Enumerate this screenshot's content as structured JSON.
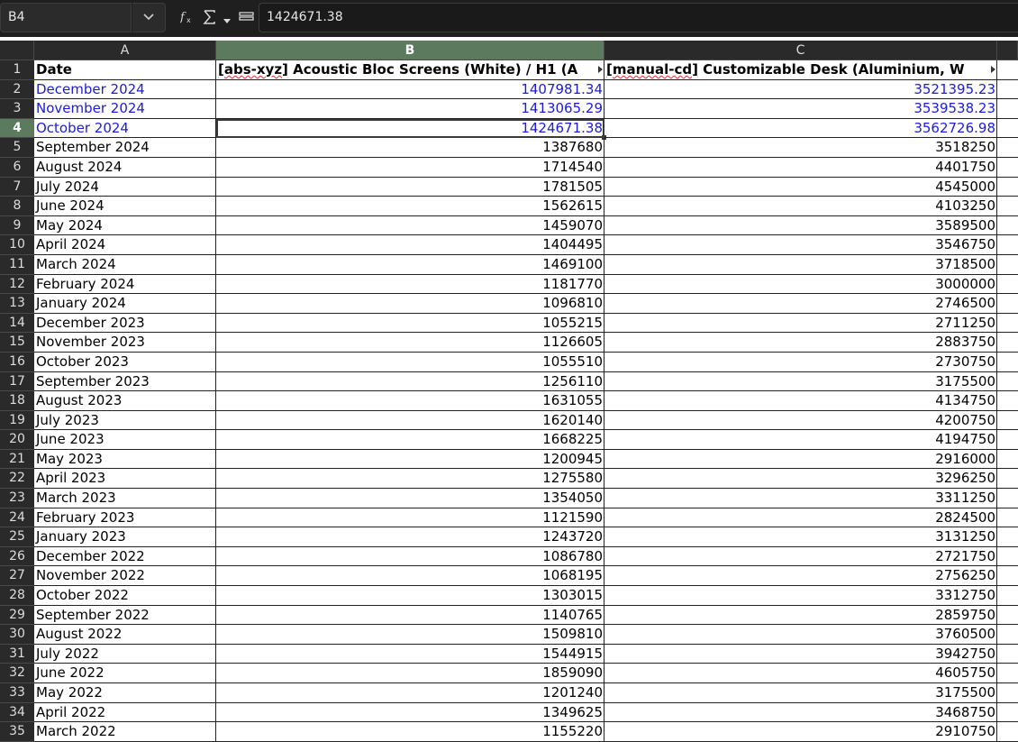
{
  "name_box": "B4",
  "formula": "1424671.38",
  "columns": [
    "A",
    "B",
    "C"
  ],
  "header_row": {
    "row": "1",
    "a": "Date",
    "b_tag": "[abs-xyz]",
    "b_rest": " Acoustic Bloc Screens (White) / H1 (A",
    "c_tag": "[manual-cd]",
    "c_rest": " Customizable Desk (Aluminium, W"
  },
  "rows": [
    {
      "row": "2",
      "date": "December 2024",
      "b": "1407981.34",
      "c": "3521395.23",
      "forecast": true
    },
    {
      "row": "3",
      "date": "November 2024",
      "b": "1413065.29",
      "c": "3539538.23",
      "forecast": true
    },
    {
      "row": "4",
      "date": "October 2024",
      "b": "1424671.38",
      "c": "3562726.98",
      "forecast": true
    },
    {
      "row": "5",
      "date": "September 2024",
      "b": "1387680",
      "c": "3518250"
    },
    {
      "row": "6",
      "date": "August 2024",
      "b": "1714540",
      "c": "4401750"
    },
    {
      "row": "7",
      "date": "July 2024",
      "b": "1781505",
      "c": "4545000"
    },
    {
      "row": "8",
      "date": "June 2024",
      "b": "1562615",
      "c": "4103250"
    },
    {
      "row": "9",
      "date": "May 2024",
      "b": "1459070",
      "c": "3589500"
    },
    {
      "row": "10",
      "date": "April 2024",
      "b": "1404495",
      "c": "3546750"
    },
    {
      "row": "11",
      "date": "March 2024",
      "b": "1469100",
      "c": "3718500"
    },
    {
      "row": "12",
      "date": "February 2024",
      "b": "1181770",
      "c": "3000000"
    },
    {
      "row": "13",
      "date": "January 2024",
      "b": "1096810",
      "c": "2746500"
    },
    {
      "row": "14",
      "date": "December 2023",
      "b": "1055215",
      "c": "2711250"
    },
    {
      "row": "15",
      "date": "November 2023",
      "b": "1126605",
      "c": "2883750"
    },
    {
      "row": "16",
      "date": "October 2023",
      "b": "1055510",
      "c": "2730750"
    },
    {
      "row": "17",
      "date": "September 2023",
      "b": "1256110",
      "c": "3175500"
    },
    {
      "row": "18",
      "date": "August 2023",
      "b": "1631055",
      "c": "4134750"
    },
    {
      "row": "19",
      "date": "July 2023",
      "b": "1620140",
      "c": "4200750"
    },
    {
      "row": "20",
      "date": "June 2023",
      "b": "1668225",
      "c": "4194750"
    },
    {
      "row": "21",
      "date": "May 2023",
      "b": "1200945",
      "c": "2916000"
    },
    {
      "row": "22",
      "date": "April 2023",
      "b": "1275580",
      "c": "3296250"
    },
    {
      "row": "23",
      "date": "March 2023",
      "b": "1354050",
      "c": "3311250"
    },
    {
      "row": "24",
      "date": "February 2023",
      "b": "1121590",
      "c": "2824500"
    },
    {
      "row": "25",
      "date": "January 2023",
      "b": "1243720",
      "c": "3131250"
    },
    {
      "row": "26",
      "date": "December 2022",
      "b": "1086780",
      "c": "2721750"
    },
    {
      "row": "27",
      "date": "November 2022",
      "b": "1068195",
      "c": "2756250"
    },
    {
      "row": "28",
      "date": "October 2022",
      "b": "1303015",
      "c": "3312750"
    },
    {
      "row": "29",
      "date": "September 2022",
      "b": "1140765",
      "c": "2859750"
    },
    {
      "row": "30",
      "date": "August 2022",
      "b": "1509810",
      "c": "3760500"
    },
    {
      "row": "31",
      "date": "July 2022",
      "b": "1544915",
      "c": "3942750"
    },
    {
      "row": "32",
      "date": "June 2022",
      "b": "1859090",
      "c": "4605750"
    },
    {
      "row": "33",
      "date": "May 2022",
      "b": "1201240",
      "c": "3175500"
    },
    {
      "row": "34",
      "date": "April 2022",
      "b": "1349625",
      "c": "3468750"
    },
    {
      "row": "35",
      "date": "March 2022",
      "b": "1155220",
      "c": "2910750"
    }
  ],
  "selection": {
    "col": "B",
    "row": "4"
  },
  "colors": {
    "toolbar_bg": "#1f1f1f",
    "header_bg": "#2a2a2a",
    "selected_header_bg": "#5b7a5e",
    "forecast_text": "#1c1cd6"
  }
}
